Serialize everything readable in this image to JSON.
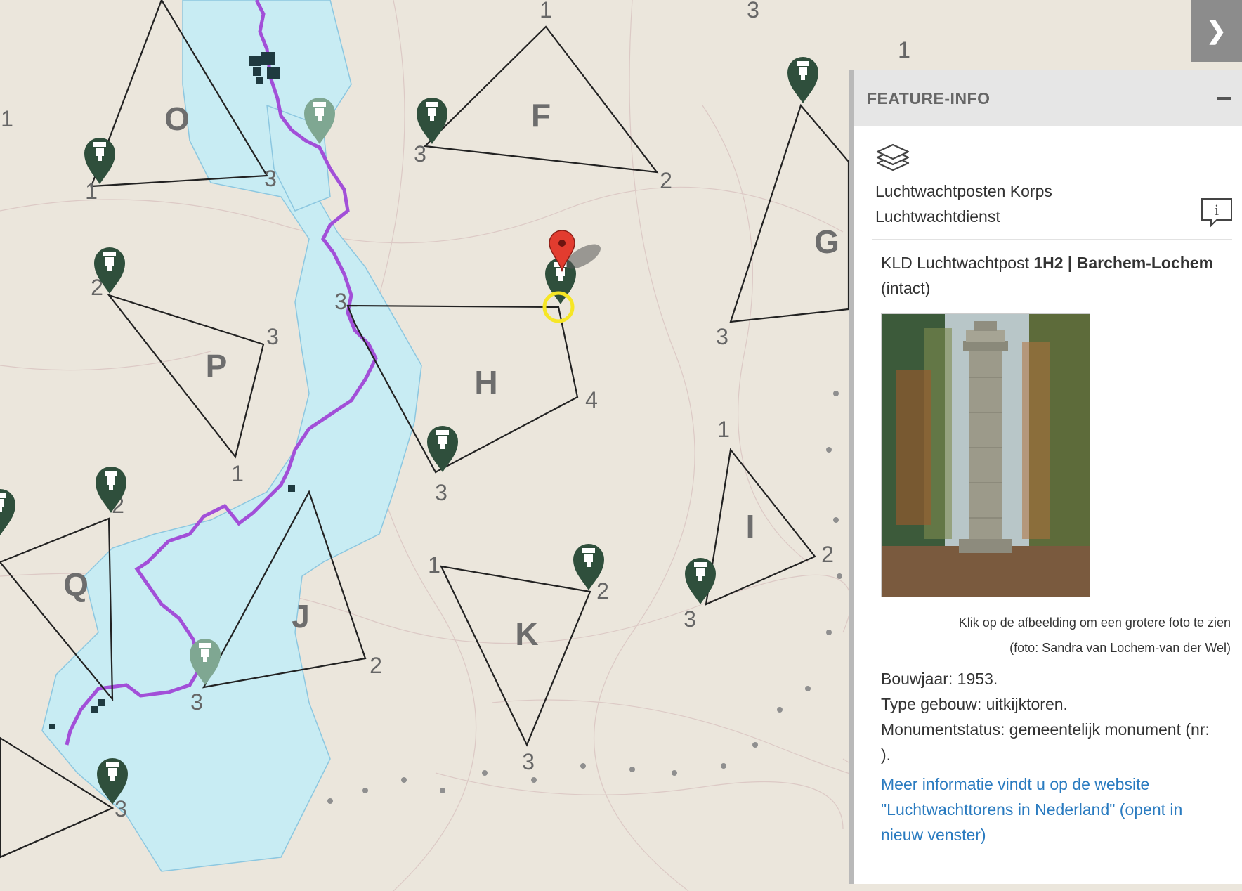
{
  "map": {
    "region_labels": [
      "O",
      "F",
      "G",
      "P",
      "H",
      "I",
      "Q",
      "J",
      "K"
    ],
    "vertex_labels": [
      "1",
      "3",
      "1",
      "3",
      "1",
      "3",
      "2",
      "1",
      "2",
      "3",
      "1",
      "3",
      "G",
      "3",
      "3",
      "4",
      "1",
      "3",
      "1",
      "2",
      "2",
      "3",
      "1",
      "2",
      "3",
      "3",
      "3",
      "3",
      "2",
      "3"
    ],
    "colors": {
      "water": "#c8ecf3",
      "river": "#a24fd8",
      "marker": "#2f4f3c",
      "marker_faded": "#7fa792",
      "selected_marker": "#e23c2f",
      "selection_ring": "#f6e626"
    },
    "icons": [
      "watchtower-marker-icon",
      "red-pin-icon",
      "selection-ring-icon"
    ]
  },
  "panel": {
    "collapse_icon": "chevron-right-icon",
    "title": "FEATURE-INFO",
    "minimize_icon": "minus-icon",
    "layer_icon": "layers-icon",
    "layer_name_line1": "Luchtwachtposten Korps",
    "layer_name_line2": "Luchtwachtdienst",
    "info_icon": "info-speech-bubble-icon",
    "feature": {
      "prefix": "KLD Luchtwachtpost ",
      "code_name": "1H2 | Barchem-Lochem",
      "status": "(intact)"
    },
    "photo_alt": "uitkijktoren Barchem-Lochem",
    "caption_click": "Klik op de afbeelding om een grotere foto te zien",
    "caption_credit": "(foto: Sandra van Lochem-van der Wel)",
    "properties": {
      "year": "Bouwjaar: 1953.",
      "type": "Type gebouw: uitkijktoren.",
      "monument": "Monumentstatus: gemeentelijk monument (nr: ).",
      "monument_line1": "Monumentstatus: gemeentelijk monument (nr:",
      "monument_line2": ")."
    },
    "link": {
      "line1": "Meer informatie vindt u op de website",
      "line2": "\"Luchtwachttorens in Nederland\" (opent in",
      "line3": "nieuw venster)"
    }
  }
}
